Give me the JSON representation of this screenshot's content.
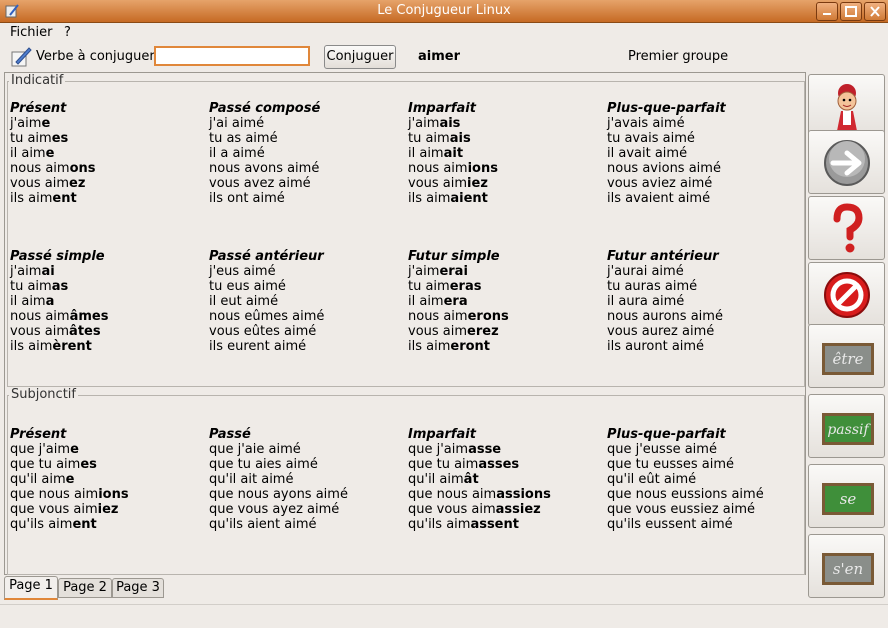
{
  "window": {
    "title": "Le Conjugueur Linux"
  },
  "menu": {
    "file": "Fichier",
    "help": "?"
  },
  "toolbar": {
    "verb_label": "Verbe à conjuguer",
    "verb_value": "",
    "conjugate_button": "Conjuguer",
    "verb": "aimer",
    "group": "Premier groupe"
  },
  "sections": {
    "indicatif": {
      "label": "Indicatif",
      "tenses": [
        {
          "name": "Présent",
          "lines": [
            [
              "j'aim",
              "e"
            ],
            [
              "tu aim",
              "es"
            ],
            [
              "il aim",
              "e"
            ],
            [
              "nous aim",
              "ons"
            ],
            [
              "vous aim",
              "ez"
            ],
            [
              "ils aim",
              "ent"
            ]
          ]
        },
        {
          "name": "Passé composé",
          "lines": [
            [
              "j'ai aimé",
              ""
            ],
            [
              "tu as aimé",
              ""
            ],
            [
              "il a aimé",
              ""
            ],
            [
              "nous avons aimé",
              ""
            ],
            [
              "vous avez aimé",
              ""
            ],
            [
              "ils ont aimé",
              ""
            ]
          ]
        },
        {
          "name": "Imparfait",
          "lines": [
            [
              "j'aim",
              "ais"
            ],
            [
              "tu aim",
              "ais"
            ],
            [
              "il aim",
              "ait"
            ],
            [
              "nous aim",
              "ions"
            ],
            [
              "vous aim",
              "iez"
            ],
            [
              "ils aim",
              "aient"
            ]
          ]
        },
        {
          "name": "Plus-que-parfait",
          "lines": [
            [
              "j'avais aimé",
              ""
            ],
            [
              "tu avais aimé",
              ""
            ],
            [
              "il avait aimé",
              ""
            ],
            [
              "nous avions aimé",
              ""
            ],
            [
              "vous aviez aimé",
              ""
            ],
            [
              "ils avaient aimé",
              ""
            ]
          ]
        },
        {
          "name": "Passé simple",
          "lines": [
            [
              "j'aim",
              "ai"
            ],
            [
              "tu aim",
              "as"
            ],
            [
              "il aim",
              "a"
            ],
            [
              "nous aim",
              "âmes"
            ],
            [
              "vous aim",
              "âtes"
            ],
            [
              "ils aim",
              "èrent"
            ]
          ]
        },
        {
          "name": "Passé antérieur",
          "lines": [
            [
              "j'eus aimé",
              ""
            ],
            [
              "tu eus aimé",
              ""
            ],
            [
              "il eut aimé",
              ""
            ],
            [
              "nous eûmes aimé",
              ""
            ],
            [
              "vous eûtes aimé",
              ""
            ],
            [
              "ils eurent aimé",
              ""
            ]
          ]
        },
        {
          "name": "Futur simple",
          "lines": [
            [
              "j'aim",
              "erai"
            ],
            [
              "tu aim",
              "eras"
            ],
            [
              "il aim",
              "era"
            ],
            [
              "nous aim",
              "erons"
            ],
            [
              "vous aim",
              "erez"
            ],
            [
              "ils aim",
              "eront"
            ]
          ]
        },
        {
          "name": "Futur antérieur",
          "lines": [
            [
              "j'aurai aimé",
              ""
            ],
            [
              "tu auras aimé",
              ""
            ],
            [
              "il aura aimé",
              ""
            ],
            [
              "nous aurons aimé",
              ""
            ],
            [
              "vous aurez aimé",
              ""
            ],
            [
              "ils auront aimé",
              ""
            ]
          ]
        }
      ]
    },
    "subjonctif": {
      "label": "Subjonctif",
      "tenses": [
        {
          "name": "Présent",
          "lines": [
            [
              "que j'aim",
              "e"
            ],
            [
              "que tu aim",
              "es"
            ],
            [
              "qu'il aim",
              "e"
            ],
            [
              "que nous aim",
              "ions"
            ],
            [
              "que vous aim",
              "iez"
            ],
            [
              "qu'ils aim",
              "ent"
            ]
          ]
        },
        {
          "name": "Passé",
          "lines": [
            [
              "que j'aie aimé",
              ""
            ],
            [
              "que tu aies aimé",
              ""
            ],
            [
              "qu'il ait aimé",
              ""
            ],
            [
              "que nous ayons aimé",
              ""
            ],
            [
              "que vous ayez aimé",
              ""
            ],
            [
              "qu'ils aient aimé",
              ""
            ]
          ]
        },
        {
          "name": "Imparfait",
          "lines": [
            [
              "que j'aim",
              "asse"
            ],
            [
              "que tu aim",
              "asses"
            ],
            [
              "qu'il aim",
              "ât"
            ],
            [
              "que nous aim",
              "assions"
            ],
            [
              "que vous aim",
              "assiez"
            ],
            [
              "qu'ils aim",
              "assent"
            ]
          ]
        },
        {
          "name": "Plus-que-parfait",
          "lines": [
            [
              "que j'eusse aimé",
              ""
            ],
            [
              "que tu eusses aimé",
              ""
            ],
            [
              "qu'il eût aimé",
              ""
            ],
            [
              "que nous eussions aimé",
              ""
            ],
            [
              "que vous eussiez aimé",
              ""
            ],
            [
              "qu'ils eussent aimé",
              ""
            ]
          ]
        }
      ]
    }
  },
  "tabs": [
    "Page 1",
    "Page 2",
    "Page 3"
  ],
  "side_buttons": [
    {
      "name": "assistant-icon",
      "label": ""
    },
    {
      "name": "arrow-right-icon",
      "label": ""
    },
    {
      "name": "help-icon",
      "label": ""
    },
    {
      "name": "stop-icon",
      "label": ""
    },
    {
      "name": "etre-board-icon",
      "label": "être"
    },
    {
      "name": "passif-board-icon",
      "label": "passif"
    },
    {
      "name": "se-board-icon",
      "label": "se"
    },
    {
      "name": "sen-board-icon",
      "label": "s'en"
    }
  ],
  "colors": {
    "titlebar": "#d07a36",
    "accent": "#e0873a",
    "board_green": "#3f8f3a",
    "board_grey": "#8a8e8a"
  }
}
